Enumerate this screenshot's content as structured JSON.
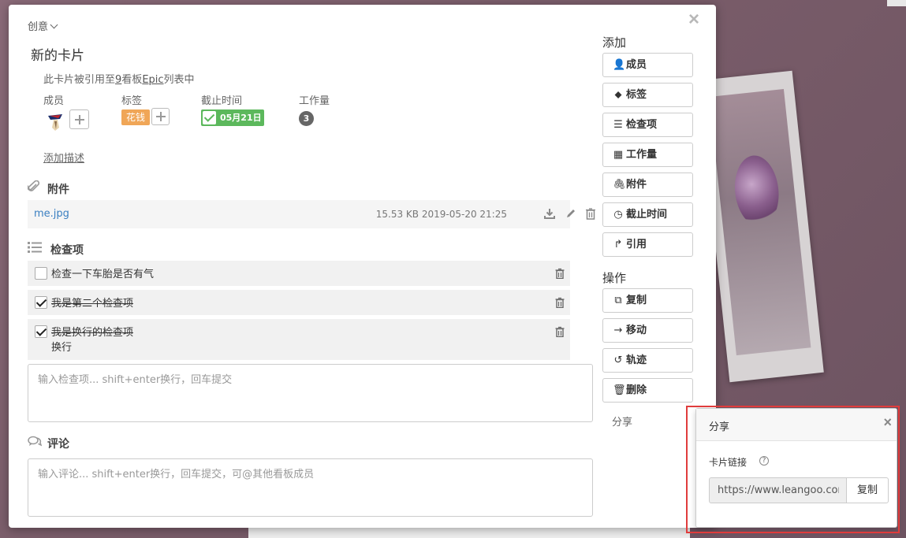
{
  "board": {
    "name": "创意"
  },
  "card": {
    "title": "新的卡片",
    "ref_prefix": "此卡片被引用至",
    "ref_count": "9",
    "ref_mid": "看板",
    "ref_list": "Epic",
    "ref_suffix": "列表中"
  },
  "fields": {
    "members_label": "成员",
    "tags_label": "标签",
    "due_label": "截止时间",
    "workload_label": "工作量",
    "tag": "花钱",
    "due_date": "05月21日",
    "workload": "3"
  },
  "add_description": "添加描述",
  "attachments": {
    "title": "附件",
    "items": [
      {
        "name": "me.jpg",
        "size": "15.53 KB",
        "date": "2019-05-20 21:25"
      }
    ]
  },
  "checklist": {
    "title": "检查项",
    "items": [
      {
        "line1": "检查一下车胎是否有气",
        "line2": "",
        "done": false
      },
      {
        "line1": "我是第二个检查项",
        "line2": "",
        "done": true
      },
      {
        "line1": "我是换行的检查项",
        "line2": "换行",
        "done": true
      }
    ],
    "placeholder": "输入检查项... shift+enter换行，回车提交"
  },
  "comments": {
    "title": "评论",
    "placeholder": "输入评论... shift+enter换行，回车提交，可@其他看板成员"
  },
  "sidebar": {
    "add_heading": "添加",
    "add_buttons": [
      "成员",
      "标签",
      "检查项",
      "工作量",
      "附件",
      "截止时间",
      "引用"
    ],
    "ops_heading": "操作",
    "op_buttons": [
      "复制",
      "移动",
      "轨迹",
      "删除"
    ],
    "share": "分享"
  },
  "share_popover": {
    "title": "分享",
    "label": "卡片链接",
    "help": "?",
    "url": "https://www.leangoo.com",
    "copy": "复制"
  },
  "colors": {
    "accent_link": "#3a7fc1",
    "tag": "#f0a657",
    "due_done": "#5cb85c",
    "highlight": "#e03c3c"
  }
}
